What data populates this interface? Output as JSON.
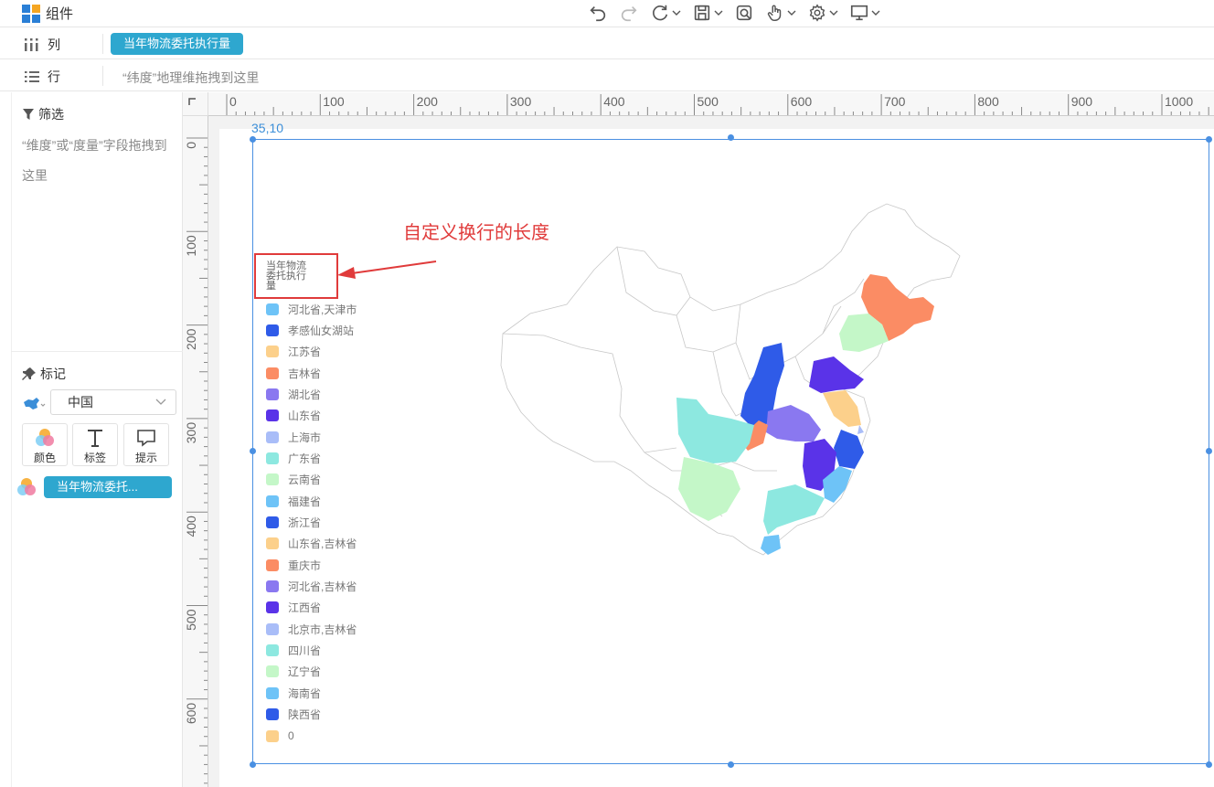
{
  "app": {
    "title": "组件"
  },
  "toolbar": {
    "items": [
      {
        "icon": "undo-icon"
      },
      {
        "icon": "redo-icon",
        "disabled": true
      },
      {
        "icon": "refresh-icon",
        "dropdown": true
      },
      {
        "icon": "save-icon",
        "dropdown": true
      },
      {
        "icon": "preview-icon"
      },
      {
        "icon": "interaction-hand-icon",
        "dropdown": true
      },
      {
        "icon": "settings-gear-icon",
        "dropdown": true
      },
      {
        "icon": "monitor-icon",
        "dropdown": true
      }
    ]
  },
  "shelves": {
    "column": {
      "label": "列",
      "field": "当年物流委托执行量"
    },
    "row": {
      "label": "行",
      "placeholder": "“纬度”地理维拖拽到这里"
    }
  },
  "filter": {
    "title": "筛选",
    "hint": "“维度”或“度量”字段拖拽到这里"
  },
  "marks": {
    "title": "标记",
    "map_type": "中国",
    "buttons": [
      {
        "label": "颜色"
      },
      {
        "label": "标签"
      },
      {
        "label": "提示"
      }
    ],
    "color_field": "当年物流委托..."
  },
  "canvas": {
    "coord": "35,10",
    "hruler_labels": [
      "0",
      "100",
      "200",
      "300",
      "400",
      "500",
      "600",
      "700",
      "800",
      "900",
      "1000"
    ],
    "vruler_labels": [
      "0",
      "100",
      "200",
      "300",
      "400",
      "500",
      "600"
    ]
  },
  "annotation": {
    "text": "自定义换行的长度",
    "color": "#e03b3b"
  },
  "legend": {
    "title": "当年物流委托执行量",
    "items": [
      {
        "label": "河北省,天津市",
        "color": "#6ec3f7"
      },
      {
        "label": "孝感仙女湖站",
        "color": "#2f5be8"
      },
      {
        "label": "江苏省",
        "color": "#fcd08b"
      },
      {
        "label": "吉林省",
        "color": "#fb8c64"
      },
      {
        "label": "湖北省",
        "color": "#8a78f0"
      },
      {
        "label": "山东省",
        "color": "#5a33e8"
      },
      {
        "label": "上海市",
        "color": "#a9bdf8"
      },
      {
        "label": "广东省",
        "color": "#8de8e0"
      },
      {
        "label": "云南省",
        "color": "#c4f7c8"
      },
      {
        "label": "福建省",
        "color": "#6ec3f7"
      },
      {
        "label": "浙江省",
        "color": "#2f5be8"
      },
      {
        "label": "山东省,吉林省",
        "color": "#fcd08b"
      },
      {
        "label": "重庆市",
        "color": "#fb8c64"
      },
      {
        "label": "河北省,吉林省",
        "color": "#8a78f0"
      },
      {
        "label": "江西省",
        "color": "#5a33e8"
      },
      {
        "label": "北京市,吉林省",
        "color": "#a9bdf8"
      },
      {
        "label": "四川省",
        "color": "#8de8e0"
      },
      {
        "label": "辽宁省",
        "color": "#c4f7c8"
      },
      {
        "label": "海南省",
        "color": "#6ec3f7"
      },
      {
        "label": "陕西省",
        "color": "#2f5be8"
      },
      {
        "label": "0",
        "color": "#fcd08b"
      }
    ]
  },
  "colors": {
    "accent": "#2ea7cf",
    "selection": "#4a90e2",
    "highlight": "#e03b3b"
  }
}
